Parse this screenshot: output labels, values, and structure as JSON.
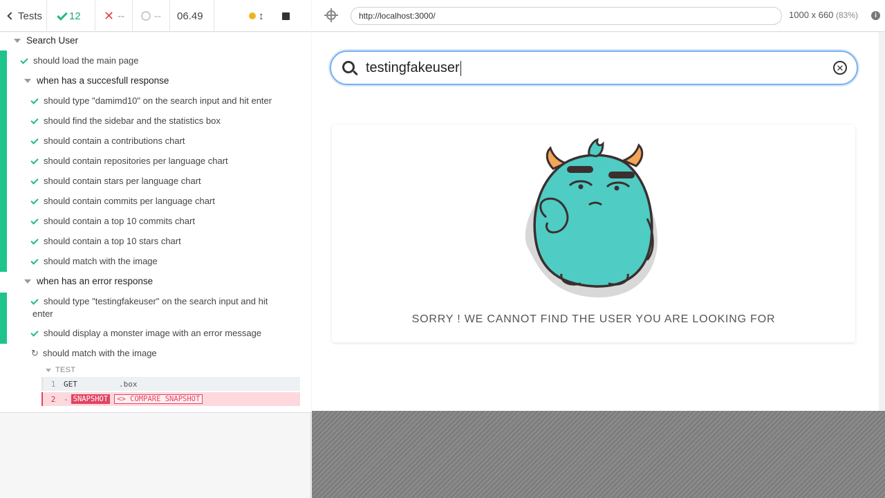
{
  "header": {
    "back_label": "Tests",
    "passed": "12",
    "failed": "--",
    "pending": "--",
    "duration": "06.49"
  },
  "tree": {
    "root_suite": "Search User",
    "test_load": "should load the main page",
    "suite_success": "when has a succesfull response",
    "success_tests": [
      "should type \"damimd10\" on the search input and hit enter",
      "should find the sidebar and the statistics box",
      "should contain a contributions chart",
      "should contain repositories per language chart",
      "should contain stars per language chart",
      "should contain commits per language chart",
      "should contain a top 10 commits chart",
      "should contain a top 10 stars chart",
      "should match with the image"
    ],
    "suite_error": "when has an error response",
    "error_tests": [
      "should type \"testingfakeuser\" on the search input and hit enter",
      "should display a monster image with an error message"
    ],
    "running_test": "should match with the image"
  },
  "commands": {
    "title": "TEST",
    "row1": {
      "num": "1",
      "name": "GET",
      "selector": ".box"
    },
    "row2": {
      "num": "2",
      "dash": "-",
      "badge": "SNAPSHOT",
      "compare": "<> COMPARE SNAPSHOT"
    }
  },
  "aut": {
    "url": "http://localhost:3000/",
    "viewport": "1000 x 660",
    "scale": "(83%)",
    "info": "i"
  },
  "app": {
    "search_value": "testingfakeuser",
    "error_message": "SORRY ! WE CANNOT FIND THE USER YOU ARE LOOKING FOR"
  },
  "colors": {
    "pass": "#1fbc7b",
    "fail": "#e24444",
    "accent_blue": "#7ab0ec",
    "monster_body": "#4fccc4",
    "monster_horn": "#f3a657",
    "snapshot": "#e24462"
  }
}
